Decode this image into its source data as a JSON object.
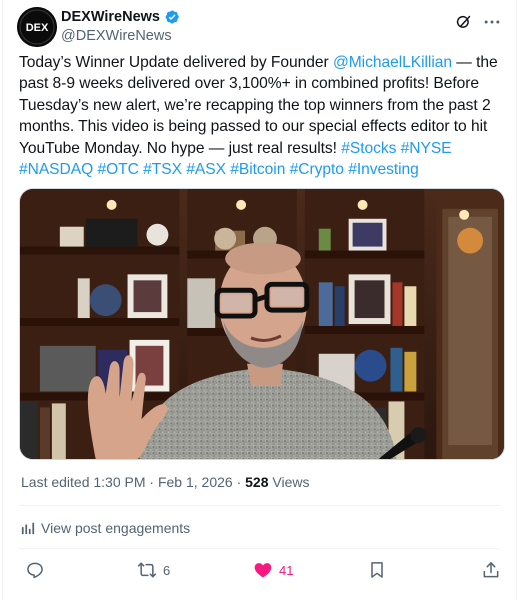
{
  "author": {
    "display_name": "DEXWireNews",
    "handle": "@DEXWireNews",
    "avatar_text": "DEX",
    "verified": true,
    "verified_color": "#1d9bf0"
  },
  "header_icons": {
    "grok": "grok-icon",
    "more": "more-icon"
  },
  "post": {
    "seg1": "Today’s Winner Update delivered by Founder ",
    "mention": "@MichaelLKillian",
    "seg2": " — the past 8-9 weeks delivered over 3,100%+ in combined profits! Before Tuesday’s new alert, we’re recapping the top winners from the past 2 months. This video is being passed to our special effects editor to hit YouTube Monday. No hype — just real results!  ",
    "hashtags": [
      "#Stocks",
      "#NYSE",
      "#NASDAQ",
      "#OTC",
      "#TSX",
      "#ASX",
      "#Bitcoin",
      "#Crypto",
      "#Investing"
    ]
  },
  "meta": {
    "edited_time": "Last edited 1:30 PM · Feb 1, 2026 · ",
    "views_count": "528",
    "views_label": " Views"
  },
  "engagements_label": "View post engagements",
  "actions": {
    "reply": {
      "icon": "reply-icon",
      "count": ""
    },
    "repost": {
      "icon": "repost-icon",
      "count": "6"
    },
    "like": {
      "icon": "heart-icon",
      "count": "41",
      "liked": true
    },
    "bookmark": {
      "icon": "bookmark-icon"
    },
    "share": {
      "icon": "share-icon"
    }
  },
  "colors": {
    "link": "#1d9bf0",
    "text": "#0f1419",
    "secondary": "#536471",
    "like": "#f91880"
  }
}
